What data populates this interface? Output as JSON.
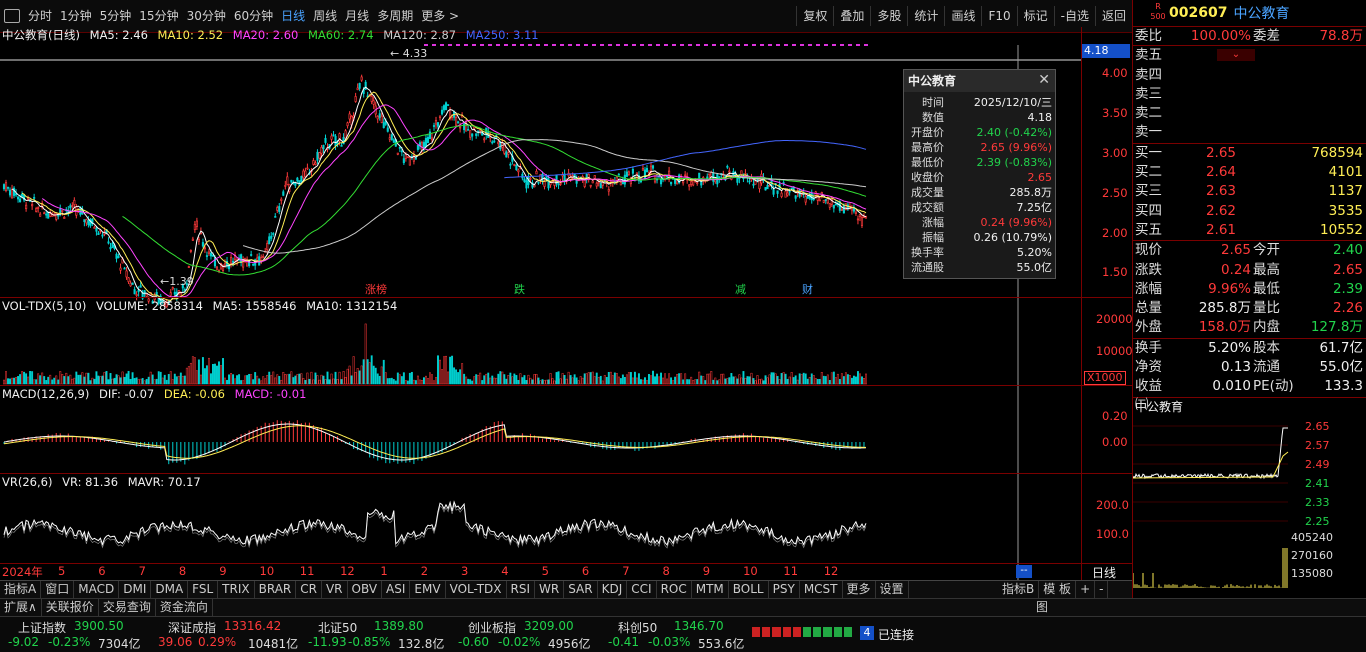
{
  "toolbar": {
    "periods": [
      "分时",
      "1分钟",
      "5分钟",
      "15分钟",
      "30分钟",
      "60分钟",
      "日线",
      "周线",
      "月线",
      "多周期",
      "更多 >"
    ],
    "active_period": "日线",
    "right_tools": [
      "复权",
      "叠加",
      "多股",
      "统计",
      "画线",
      "F10",
      "标记",
      "-自选",
      "返回"
    ]
  },
  "main_legend": {
    "title": "中公教育(日线)",
    "ma5": "MA5: 2.46",
    "ma10": "MA10: 2.52",
    "ma20": "MA20: 2.60",
    "ma60": "MA60: 2.74",
    "ma120": "MA120: 2.87",
    "ma250": "MA250: 3.11"
  },
  "price_axis": {
    "labels": [
      "4.00",
      "3.50",
      "3.00",
      "2.50",
      "2.00",
      "1.50"
    ],
    "current": "4.18",
    "high_mark": "4.33",
    "low_mark": "1.39"
  },
  "event_tags": [
    "涨榜",
    "跌",
    "减",
    "财"
  ],
  "vol_legend": {
    "title": "VOL-TDX(5,10)",
    "volume": "VOLUME: 2858314",
    "ma5": "MA5: 1558546",
    "ma10": "MA10: 1312154",
    "axis": [
      "20000",
      "10000"
    ],
    "unit": "X1000"
  },
  "macd_legend": {
    "title": "MACD(12,26,9)",
    "dif": "DIF: -0.07",
    "dea": "DEA: -0.06",
    "macd": "MACD: -0.01",
    "axis": [
      "0.20",
      "0.00"
    ]
  },
  "vr_legend": {
    "title": "VR(26,6)",
    "vr": "VR: 81.36",
    "mavr": "MAVR: 70.17",
    "axis": [
      "200.0",
      "100.0"
    ]
  },
  "months": [
    "2024年",
    "5",
    "6",
    "7",
    "8",
    "9",
    "10",
    "11",
    "12",
    "1",
    "2",
    "3",
    "4",
    "5",
    "6",
    "7",
    "8",
    "9",
    "10",
    "11",
    "12"
  ],
  "period_label": "日线",
  "tooltip": {
    "title": "中公教育",
    "rows": [
      {
        "k": "时间",
        "v": "2025/12/10/三",
        "c": "white"
      },
      {
        "k": "数值",
        "v": "4.18",
        "c": "white"
      },
      {
        "k": "开盘价",
        "v": "2.40 (-0.42%)",
        "c": "green"
      },
      {
        "k": "最高价",
        "v": "2.65 (9.96%)",
        "c": "red"
      },
      {
        "k": "最低价",
        "v": "2.39 (-0.83%)",
        "c": "green"
      },
      {
        "k": "收盘价",
        "v": "2.65",
        "c": "red"
      },
      {
        "k": "成交量",
        "v": "285.8万",
        "c": "white"
      },
      {
        "k": "成交额",
        "v": "7.25亿",
        "c": "white"
      },
      {
        "k": "涨幅",
        "v": "0.24 (9.96%)",
        "c": "red"
      },
      {
        "k": "振幅",
        "v": "0.26 (10.79%)",
        "c": "white"
      },
      {
        "k": "换手率",
        "v": "5.20%",
        "c": "white"
      },
      {
        "k": "流通股",
        "v": "55.0亿",
        "c": "white"
      }
    ]
  },
  "quote": {
    "code": "002607",
    "name": "中公教育",
    "wb_label": "委比",
    "wb": "100.00%",
    "wc_label": "委差",
    "wc": "78.8万",
    "sells": [
      "卖五",
      "卖四",
      "卖三",
      "卖二",
      "卖一"
    ],
    "buys": [
      {
        "l": "买一",
        "p": "2.65",
        "v": "768594"
      },
      {
        "l": "买二",
        "p": "2.64",
        "v": "4101"
      },
      {
        "l": "买三",
        "p": "2.63",
        "v": "1137"
      },
      {
        "l": "买四",
        "p": "2.62",
        "v": "3535"
      },
      {
        "l": "买五",
        "p": "2.61",
        "v": "10552"
      }
    ],
    "stats": [
      {
        "l1": "现价",
        "v1": "2.65",
        "c1": "red",
        "l2": "今开",
        "v2": "2.40",
        "c2": "green"
      },
      {
        "l1": "涨跌",
        "v1": "0.24",
        "c1": "red",
        "l2": "最高",
        "v2": "2.65",
        "c2": "red"
      },
      {
        "l1": "涨幅",
        "v1": "9.96%",
        "c1": "red",
        "l2": "最低",
        "v2": "2.39",
        "c2": "green"
      },
      {
        "l1": "总量",
        "v1": "285.8万",
        "c1": "white",
        "l2": "量比",
        "v2": "2.26",
        "c2": "red"
      },
      {
        "l1": "外盘",
        "v1": "158.0万",
        "c1": "red",
        "l2": "内盘",
        "v2": "127.8万",
        "c2": "green"
      }
    ],
    "stats2": [
      {
        "l1": "换手",
        "v1": "5.20%",
        "l2": "股本",
        "v2": "61.7亿"
      },
      {
        "l1": "净资",
        "v1": "0.13",
        "l2": "流通",
        "v2": "55.0亿"
      },
      {
        "l1": "收益㈢",
        "v1": "0.010",
        "l2": "PE(动)",
        "v2": "133.3"
      }
    ],
    "mini_title": "中公教育",
    "mini_price_axis": [
      "2.65",
      "2.57",
      "2.49",
      "2.41",
      "2.33",
      "2.25"
    ],
    "mini_vol_axis": [
      "405240",
      "270160",
      "135080"
    ]
  },
  "indicator_tabs": [
    "指标A",
    "窗口",
    "MACD",
    "DMI",
    "DMA",
    "FSL",
    "TRIX",
    "BRAR",
    "CR",
    "VR",
    "OBV",
    "ASI",
    "EMV",
    "VOL-TDX",
    "RSI",
    "WR",
    "SAR",
    "KDJ",
    "CCI",
    "ROC",
    "MTM",
    "BOLL",
    "PSY",
    "MCST",
    "更多",
    "设置"
  ],
  "indicator_right": [
    "指标B",
    "模 板",
    "+",
    "-"
  ],
  "bottom_tabs": [
    "扩展∧",
    "关联报价",
    "交易查询",
    "资金流向"
  ],
  "bottom_right": "图",
  "indices": [
    {
      "name": "上证指数",
      "value": "3900.50",
      "chg": "-9.02",
      "pct": "-0.23%",
      "amt": "7304亿",
      "dir": "down"
    },
    {
      "name": "深证成指",
      "value": "13316.42",
      "chg": "39.06",
      "pct": "0.29%",
      "amt": "10481亿",
      "dir": "up"
    },
    {
      "name": "北证50",
      "value": "1389.80",
      "chg": "-11.93",
      "pct": "-0.85%",
      "amt": "132.8亿",
      "dir": "down"
    },
    {
      "name": "创业板指",
      "value": "3209.00",
      "chg": "-0.60",
      "pct": "-0.02%",
      "amt": "4956亿",
      "dir": "down"
    },
    {
      "name": "科创50",
      "value": "1346.70",
      "chg": "-0.41",
      "pct": "-0.03%",
      "amt": "553.6亿",
      "dir": "down"
    }
  ],
  "connection": "已连接",
  "connection_num": "4",
  "colors": {
    "up": "#ff3a3a",
    "down": "#21d44c",
    "ma5": "#ffffff",
    "ma10": "#ffee55",
    "ma20": "#ff44ff",
    "ma60": "#33dd33",
    "ma120": "#cccccc",
    "ma250": "#4466ff"
  }
}
